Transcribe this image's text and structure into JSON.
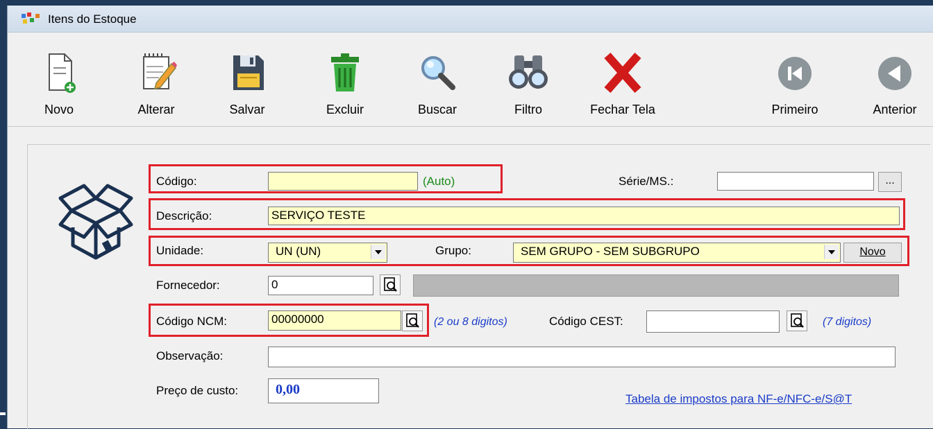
{
  "window": {
    "title": "Itens do Estoque"
  },
  "toolbar": {
    "novo": "Novo",
    "alterar": "Alterar",
    "salvar": "Salvar",
    "excluir": "Excluir",
    "buscar": "Buscar",
    "filtro": "Filtro",
    "fechar": "Fechar Tela",
    "primeiro": "Primeiro",
    "anterior": "Anterior"
  },
  "form": {
    "codigo_label": "Código:",
    "codigo_value": "",
    "codigo_hint": "(Auto)",
    "serie_label": "Série/MS.:",
    "serie_value": "",
    "serie_btn": "...",
    "descricao_label": "Descrição:",
    "descricao_value": "SERVIÇO TESTE",
    "unidade_label": "Unidade:",
    "unidade_value": "UN (UN)",
    "grupo_label": "Grupo:",
    "grupo_value": "SEM GRUPO - SEM SUBGRUPO",
    "grupo_novo": "Novo",
    "fornecedor_label": "Fornecedor:",
    "fornecedor_value": "0",
    "ncm_label": "Código NCM:",
    "ncm_value": "00000000",
    "ncm_hint": "(2 ou 8 digitos)",
    "cest_label": "Código CEST:",
    "cest_value": "",
    "cest_hint": "(7 digitos)",
    "obs_label": "Observação:",
    "obs_value": "",
    "preco_label": "Preço de custo:",
    "preco_value": "0,00",
    "tabela_link": "Tabela de impostos para NF-e/NFC-e/S@T"
  },
  "colors": {
    "highlight": "#e0202a",
    "link": "#1a3cc8",
    "input_yellow": "#ffffc8"
  }
}
